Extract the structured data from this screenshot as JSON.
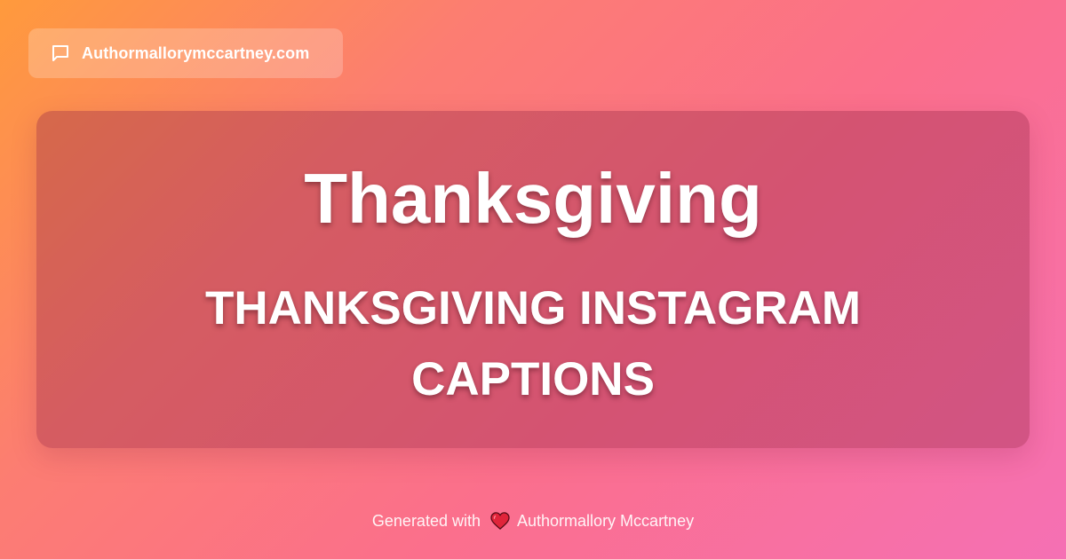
{
  "site_badge": {
    "icon": "chat-bubble-icon",
    "label": "Authormallorymccartney.com"
  },
  "card": {
    "title": "Thanksgiving",
    "subtitle": "THANKSGIVING INSTAGRAM CAPTIONS"
  },
  "footer": {
    "prefix": "Generated with",
    "icon": "heart-icon",
    "author": "Authormallory Mccartney"
  },
  "colors": {
    "gradient_start": "#ff9a3c",
    "gradient_end": "#f570b4",
    "heart": "#e0243a"
  }
}
